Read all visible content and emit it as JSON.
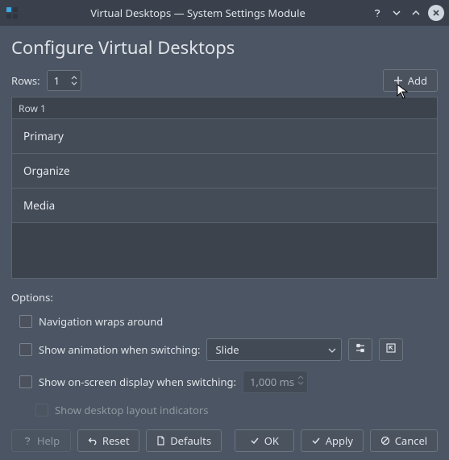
{
  "window": {
    "title": "Virtual Desktops — System Settings Module"
  },
  "header": {
    "title": "Configure Virtual Desktops"
  },
  "rows": {
    "label": "Rows:",
    "value": "1"
  },
  "add_button": {
    "label": "Add"
  },
  "desktops": {
    "group_label": "Row 1",
    "items": [
      {
        "name": "Primary"
      },
      {
        "name": "Organize"
      },
      {
        "name": "Media"
      }
    ]
  },
  "options": {
    "label": "Options:",
    "nav_wraps": "Navigation wraps around",
    "show_anim": "Show animation when switching:",
    "anim_select": "Slide",
    "show_osd": "Show on-screen display when switching:",
    "osd_ms": "1,000 ms",
    "show_layout_indicators": "Show desktop layout indicators"
  },
  "footer": {
    "help": "Help",
    "reset": "Reset",
    "defaults": "Defaults",
    "ok": "OK",
    "apply": "Apply",
    "cancel": "Cancel"
  }
}
